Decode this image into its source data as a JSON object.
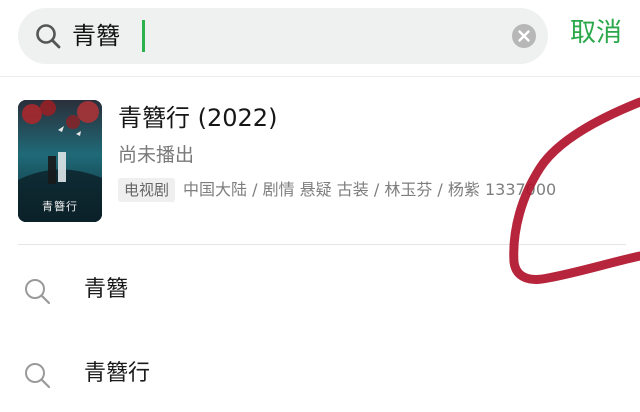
{
  "search": {
    "query": "青簪",
    "cancel_label": "取消"
  },
  "result": {
    "poster_title": "青簪行",
    "title": "青簪行 (2022)",
    "status": "尚未播出",
    "type_badge": "电视剧",
    "meta": "中国大陆 / 剧情 悬疑 古装 / 林玉芬 / 杨紫 1337000"
  },
  "suggestions": [
    {
      "label": "青簪"
    },
    {
      "label": "青簪行"
    }
  ],
  "colors": {
    "accent": "#2aa84a",
    "search_bg": "#eef1ef",
    "scribble": "#b0122a"
  }
}
